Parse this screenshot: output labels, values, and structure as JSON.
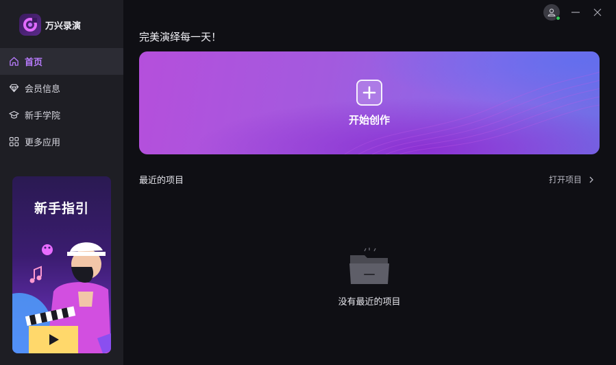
{
  "app": {
    "name": "万兴录演"
  },
  "sidebar": {
    "items": [
      {
        "label": "首页",
        "icon": "home-icon",
        "active": true
      },
      {
        "label": "会员信息",
        "icon": "diamond-icon",
        "active": false
      },
      {
        "label": "新手学院",
        "icon": "graduation-cap-icon",
        "active": false
      },
      {
        "label": "更多应用",
        "icon": "apps-grid-icon",
        "active": false
      }
    ],
    "guide_card": {
      "title": "新手指引"
    }
  },
  "header": {
    "greeting": "完美演绎每一天！"
  },
  "hero": {
    "label": "开始创作",
    "icon": "plus-icon"
  },
  "recent": {
    "title": "最近的项目",
    "open_label": "打开项目",
    "empty_text": "没有最近的项目"
  },
  "colors": {
    "accent": "#b97cff",
    "sidebar_bg": "#1e1e24",
    "main_bg": "#0f0f14",
    "online_dot": "#34c759"
  }
}
